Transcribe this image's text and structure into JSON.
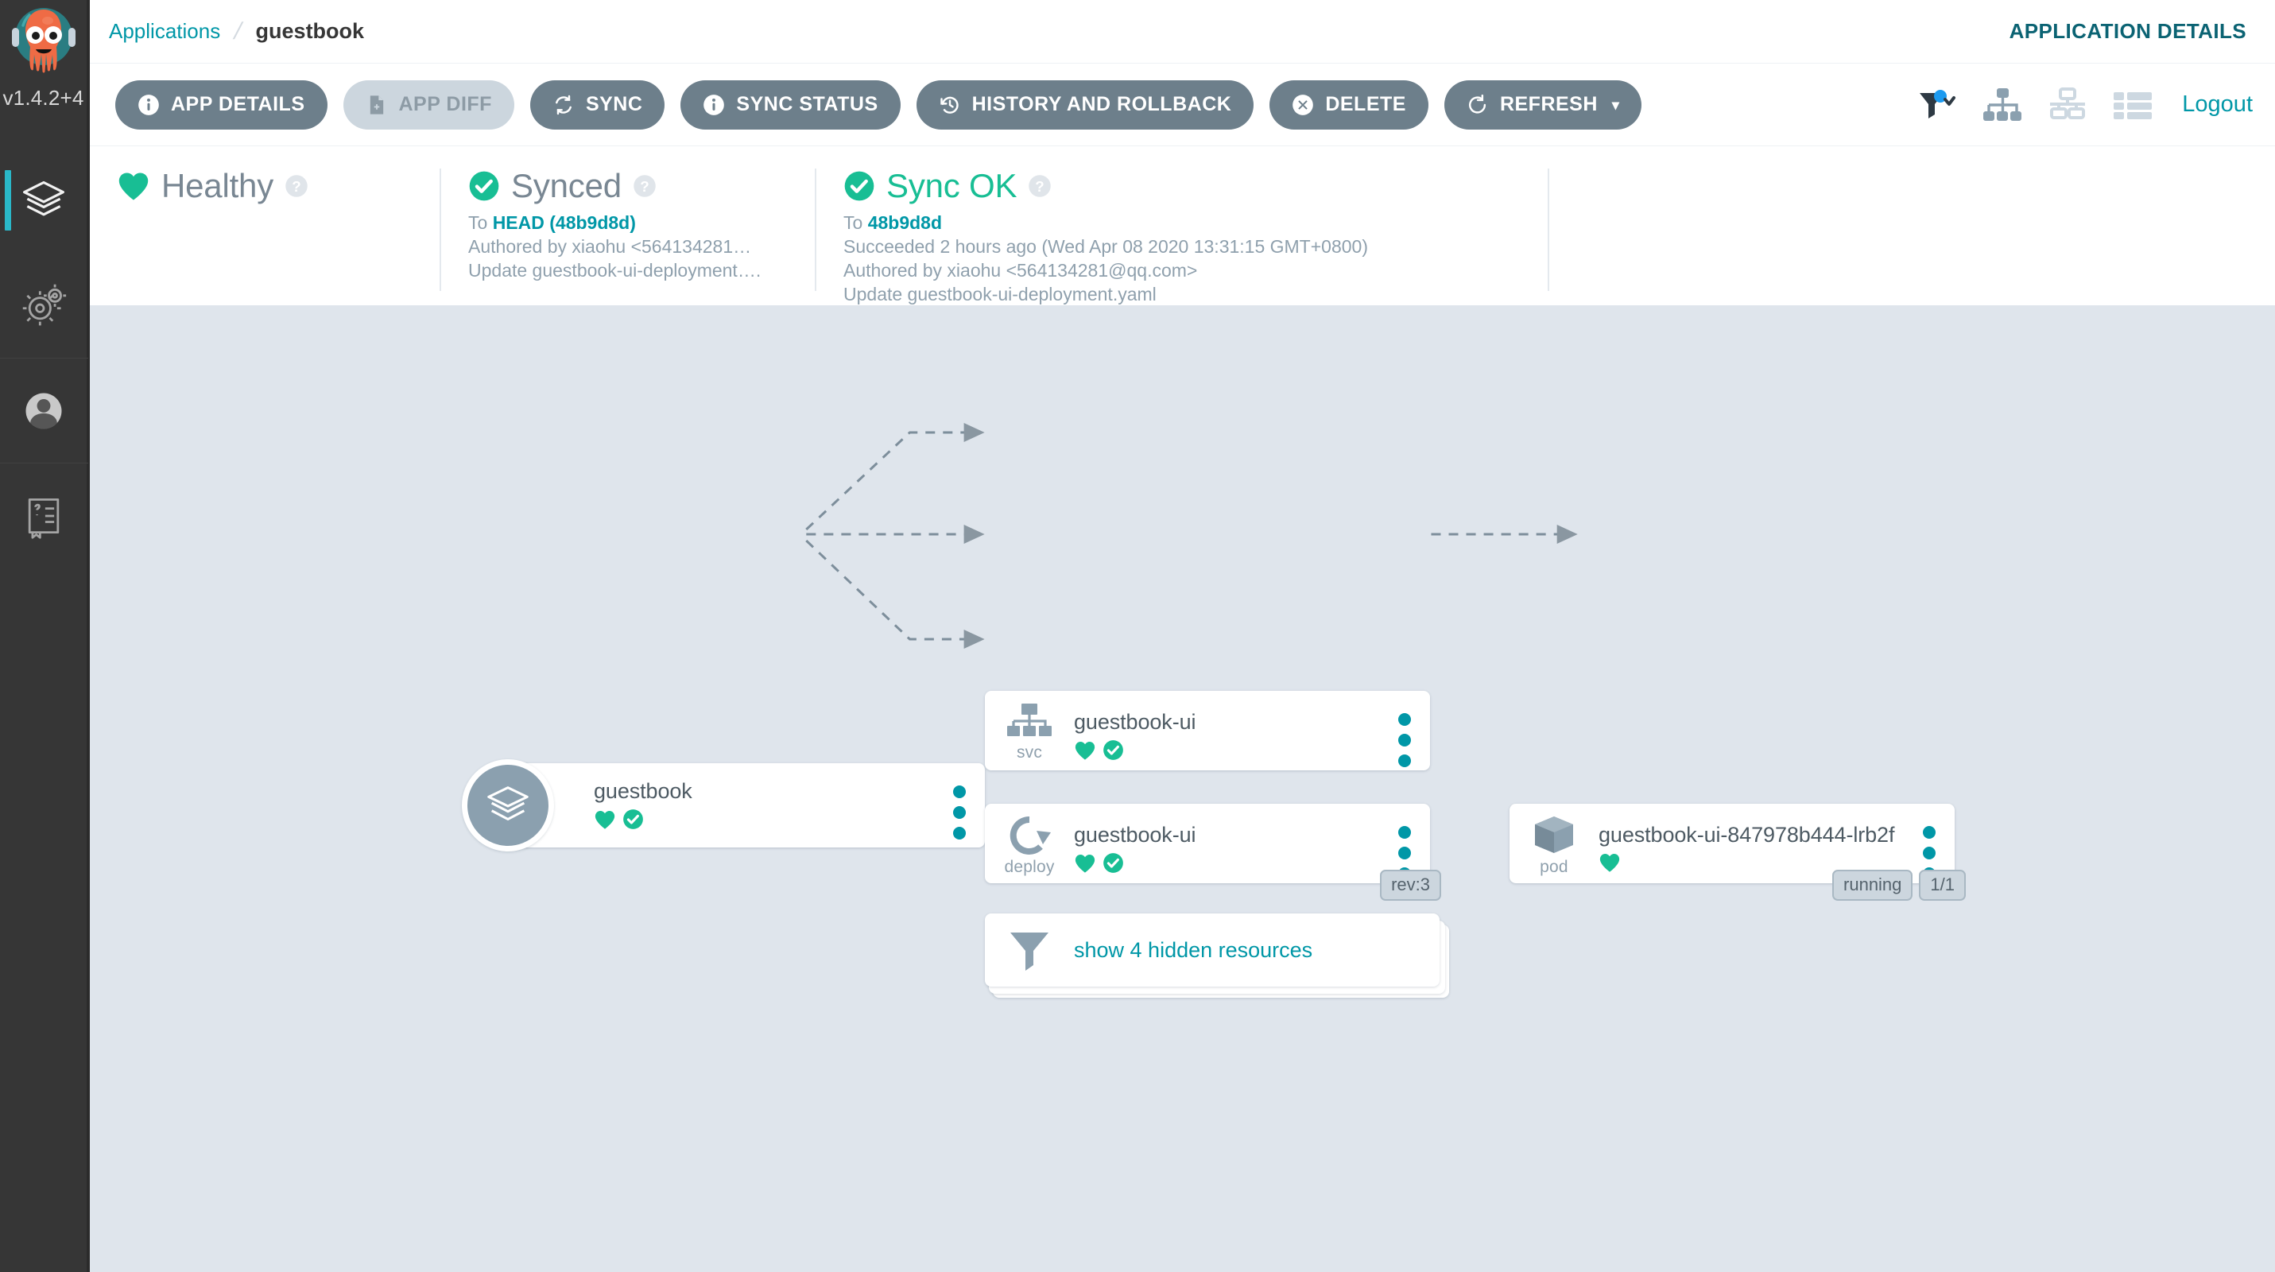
{
  "sidebar": {
    "logo_icon": "argo-octopus-logo",
    "version": "v1.4.2+4",
    "items": [
      {
        "name": "applications",
        "icon": "layers-icon",
        "active": true
      },
      {
        "name": "settings",
        "icon": "gears-icon",
        "active": false
      },
      {
        "name": "user-info",
        "icon": "user-circle-icon",
        "active": false
      },
      {
        "name": "documentation",
        "icon": "book-question-icon",
        "active": false
      }
    ]
  },
  "topbar": {
    "breadcrumb_root": "Applications",
    "breadcrumb_separator": "/",
    "breadcrumb_current": "guestbook",
    "app_details_link": "APPLICATION DETAILS"
  },
  "toolbar": {
    "buttons": [
      {
        "label": "APP DETAILS",
        "icon": "info-circle-icon",
        "disabled": false
      },
      {
        "label": "APP DIFF",
        "icon": "file-diff-icon",
        "disabled": true
      },
      {
        "label": "SYNC",
        "icon": "sync-arrows-icon",
        "disabled": false
      },
      {
        "label": "SYNC STATUS",
        "icon": "info-circle-icon",
        "disabled": false
      },
      {
        "label": "HISTORY AND ROLLBACK",
        "icon": "history-clock-icon",
        "disabled": false
      },
      {
        "label": "DELETE",
        "icon": "times-circle-icon",
        "disabled": false
      },
      {
        "label": "REFRESH",
        "icon": "refresh-icon",
        "disabled": false,
        "caret": "▾"
      }
    ],
    "right_icons": [
      {
        "name": "filter-icon"
      },
      {
        "name": "tree-view-icon"
      },
      {
        "name": "network-view-icon"
      },
      {
        "name": "list-view-icon"
      }
    ],
    "logout_label": "Logout"
  },
  "status": {
    "health": {
      "icon": "heart-icon",
      "label": "Healthy",
      "help": "?"
    },
    "sync": {
      "icon": "check-circle-icon",
      "label": "Synced",
      "help": "?",
      "to_prefix": "To ",
      "to_target": "HEAD (48b9d8d)",
      "author": "Authored by xiaohu <564134281…",
      "message": "Update guestbook-ui-deployment…."
    },
    "operation": {
      "icon": "check-circle-icon",
      "label": "Sync OK",
      "help": "?",
      "to_prefix": "To ",
      "to_target": "48b9d8d",
      "succeeded": "Succeeded 2 hours ago (Wed Apr 08 2020 13:31:15 GMT+0800)",
      "author": "Authored by xiaohu <564134281@qq.com>",
      "message": "Update guestbook-ui-deployment.yaml"
    }
  },
  "graph": {
    "app_node": {
      "icon": "layers-icon",
      "title": "guestbook",
      "badges": [
        "heart-icon",
        "check-circle-icon"
      ]
    },
    "nodes": [
      {
        "kind": "svc",
        "icon": "service-tree-icon",
        "title": "guestbook-ui",
        "badges": [
          "heart-icon",
          "check-circle-icon"
        ],
        "pills": []
      },
      {
        "kind": "deploy",
        "icon": "deployment-circle-arrow-icon",
        "title": "guestbook-ui",
        "badges": [
          "heart-icon",
          "check-circle-icon"
        ],
        "pills": [
          "rev:3"
        ]
      },
      {
        "kind": "pod",
        "icon": "pod-cube-icon",
        "title": "guestbook-ui-847978b444-lrb2f",
        "badges": [
          "heart-icon"
        ],
        "pills": [
          "running",
          "1/1"
        ]
      }
    ],
    "hidden_resources": {
      "icon": "filter-funnel-icon",
      "label": "show 4 hidden resources"
    }
  },
  "colors": {
    "accent_teal": "#0097a7",
    "healthy_green": "#18be94",
    "button_grey": "#6d7f8b",
    "button_disabled": "#ccd6de",
    "canvas_bg": "#dfe5ec",
    "sidebar_bg": "#363636",
    "sidebar_active": "#2ab8c9"
  }
}
